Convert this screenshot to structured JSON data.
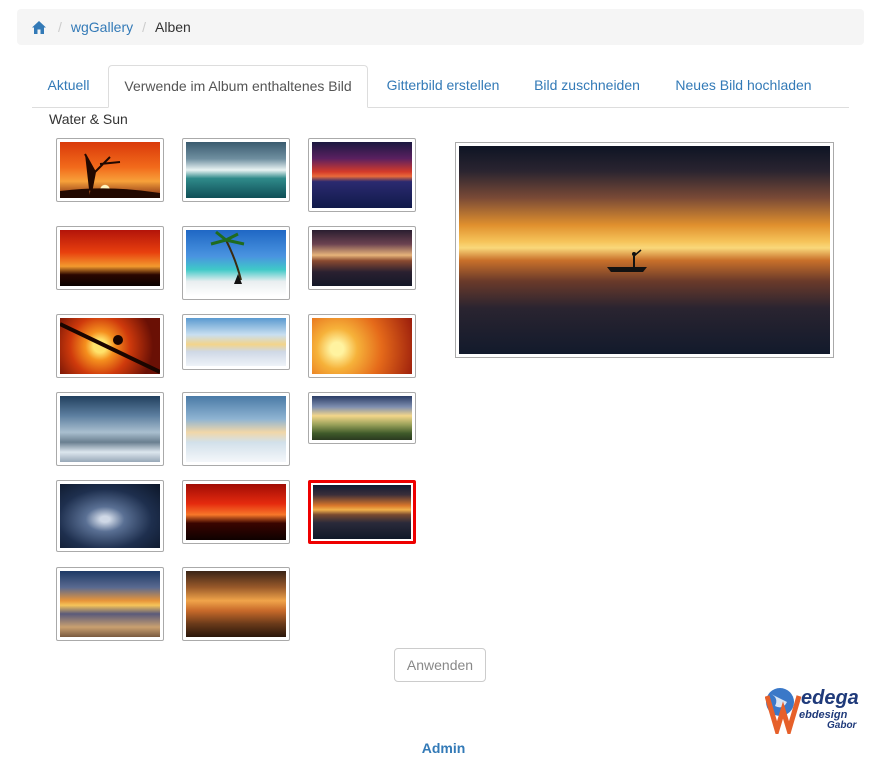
{
  "breadcrumb": {
    "home_icon": "home-icon",
    "items": [
      "wgGallery",
      "Alben"
    ]
  },
  "tabs": [
    {
      "label": "Aktuell",
      "active": false
    },
    {
      "label": "Verwende im Album enthaltenes Bild",
      "active": true
    },
    {
      "label": "Gitterbild erstellen",
      "active": false
    },
    {
      "label": "Bild zuschneiden",
      "active": false
    },
    {
      "label": "Neues Bild hochladen",
      "active": false
    }
  ],
  "album": {
    "title": "Water & Sun",
    "selected_index": 14
  },
  "apply_button": "Anwenden",
  "footer": {
    "admin_link": "Admin"
  },
  "logo": {
    "text_main": "edega",
    "text_sub1": "ebdesign",
    "text_sub2": "Gabor"
  },
  "colors": {
    "link": "#337ab7",
    "selected_border": "#ee0000"
  }
}
